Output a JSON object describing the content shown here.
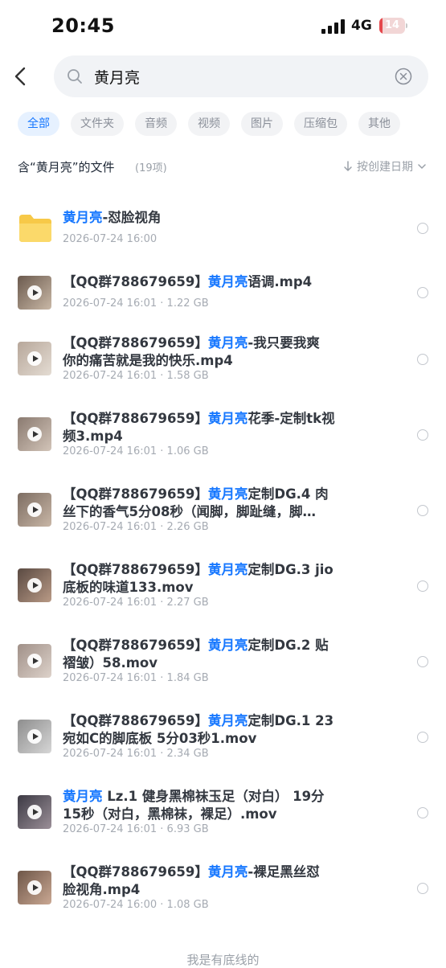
{
  "status_bar": {
    "time": "20:45",
    "network": "4G",
    "battery": "14",
    "battery_level": 0.14
  },
  "search": {
    "query": "黄月亮"
  },
  "filters": [
    {
      "label": "全部",
      "active": true
    },
    {
      "label": "文件夹",
      "active": false
    },
    {
      "label": "音频",
      "active": false
    },
    {
      "label": "视频",
      "active": false
    },
    {
      "label": "图片",
      "active": false
    },
    {
      "label": "压缩包",
      "active": false
    },
    {
      "label": "其他",
      "active": false
    }
  ],
  "section": {
    "title": "含“黄月亮”的文件",
    "count": "(19项)",
    "sort_label": "按创建日期"
  },
  "items": [
    {
      "kind": "folder",
      "line1": [
        {
          "t": "黄月亮",
          "h": true
        },
        {
          "t": "-怼脸视角",
          "h": false
        }
      ],
      "line2": [],
      "meta": "2026-07-24 16:00",
      "thumb_colors": [
        "#f7c948",
        "#fbd96a"
      ]
    },
    {
      "kind": "video",
      "line1": [
        {
          "t": "【QQ群788679659】",
          "h": false
        },
        {
          "t": "黄月亮",
          "h": true
        },
        {
          "t": "语调.mp4",
          "h": false
        }
      ],
      "line2": [],
      "meta": "2026-07-24 16:01 · 1.22 GB",
      "thumb_colors": [
        "#6b5a4e",
        "#c9b8a6"
      ]
    },
    {
      "kind": "video",
      "line1": [
        {
          "t": "【QQ群788679659】",
          "h": false
        },
        {
          "t": "黄月亮",
          "h": true
        },
        {
          "t": "-我只要我爽",
          "h": false
        }
      ],
      "line2": [
        {
          "t": "你的痛苦就是我的快乐.mp4",
          "h": false
        }
      ],
      "meta": "2026-07-24 16:01 · 1.58 GB",
      "thumb_colors": [
        "#b7a79a",
        "#e4dcd3"
      ]
    },
    {
      "kind": "video",
      "line1": [
        {
          "t": "【QQ群788679659】",
          "h": false
        },
        {
          "t": "黄月亮",
          "h": true
        },
        {
          "t": "花季-定制tk视",
          "h": false
        }
      ],
      "line2": [
        {
          "t": "频3.mp4",
          "h": false
        }
      ],
      "meta": "2026-07-24 16:01 · 1.06 GB",
      "thumb_colors": [
        "#8a7a70",
        "#d2c4b8"
      ]
    },
    {
      "kind": "video",
      "line1": [
        {
          "t": "【QQ群788679659】",
          "h": false
        },
        {
          "t": "黄月亮",
          "h": true
        },
        {
          "t": "定制DG.4 肉",
          "h": false
        }
      ],
      "line2": [
        {
          "t": "丝下的香气5分08秒（闻脚，脚趾缝，脚…",
          "h": false
        }
      ],
      "meta": "2026-07-24 16:01 · 2.26 GB",
      "thumb_colors": [
        "#7d6d62",
        "#c8b6a6"
      ]
    },
    {
      "kind": "video",
      "line1": [
        {
          "t": "【QQ群788679659】",
          "h": false
        },
        {
          "t": "黄月亮",
          "h": true
        },
        {
          "t": "定制DG.3 jio",
          "h": false
        }
      ],
      "line2": [
        {
          "t": "底板的味道133.mov",
          "h": false
        }
      ],
      "meta": "2026-07-24 16:01 · 2.27 GB",
      "thumb_colors": [
        "#5a4a42",
        "#b99a86"
      ]
    },
    {
      "kind": "video",
      "line1": [
        {
          "t": "【QQ群788679659】",
          "h": false
        },
        {
          "t": "黄月亮",
          "h": true
        },
        {
          "t": "定制DG.2 贴",
          "h": false
        }
      ],
      "line2": [
        {
          "t": "褶皱）58.mov",
          "h": false
        }
      ],
      "meta": "2026-07-24 16:01 · 1.84 GB",
      "thumb_colors": [
        "#a09088",
        "#ddd2ca"
      ]
    },
    {
      "kind": "video",
      "line1": [
        {
          "t": "【QQ群788679659】",
          "h": false
        },
        {
          "t": "黄月亮",
          "h": true
        },
        {
          "t": "定制DG.1 23",
          "h": false
        }
      ],
      "line2": [
        {
          "t": "宛如C的脚底板 5分03秒1.mov",
          "h": false
        }
      ],
      "meta": "2026-07-24 16:01 · 2.34 GB",
      "thumb_colors": [
        "#8e8e8e",
        "#d6d6d6"
      ]
    },
    {
      "kind": "video",
      "line1": [
        {
          "t": "黄月亮",
          "h": true
        },
        {
          "t": " Lz.1 健身黑棉袜玉足（对白） 19分",
          "h": false
        }
      ],
      "line2": [
        {
          "t": "15秒（对白，黑棉袜，裸足）.mov",
          "h": false
        }
      ],
      "meta": "2026-07-24 16:01 · 6.93 GB",
      "thumb_colors": [
        "#3c3a44",
        "#9b8f98"
      ]
    },
    {
      "kind": "video",
      "line1": [
        {
          "t": "【QQ群788679659】",
          "h": false
        },
        {
          "t": "黄月亮",
          "h": true
        },
        {
          "t": "-裸足黑丝怼",
          "h": false
        }
      ],
      "line2": [
        {
          "t": "脸视角.mp4",
          "h": false
        }
      ],
      "meta": "2026-07-24 16:00 · 1.08 GB",
      "thumb_colors": [
        "#6e5648",
        "#caa893"
      ]
    }
  ],
  "footer": "我是有底线的"
}
